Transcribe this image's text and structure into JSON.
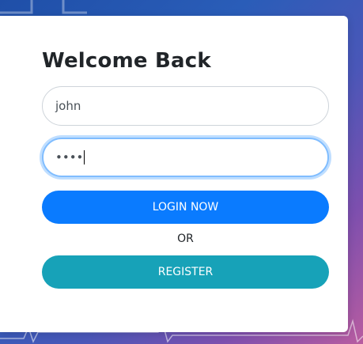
{
  "login_card": {
    "title": "Welcome Back",
    "username": {
      "value": "john"
    },
    "password": {
      "masked_value": "••••"
    },
    "login_button_label": "LOGIN NOW",
    "separator_text": "OR",
    "register_button_label": "REGISTER"
  },
  "colors": {
    "login_button": "#0a7bff",
    "register_button": "#17a2b8",
    "focus_ring": "#80bdff"
  }
}
